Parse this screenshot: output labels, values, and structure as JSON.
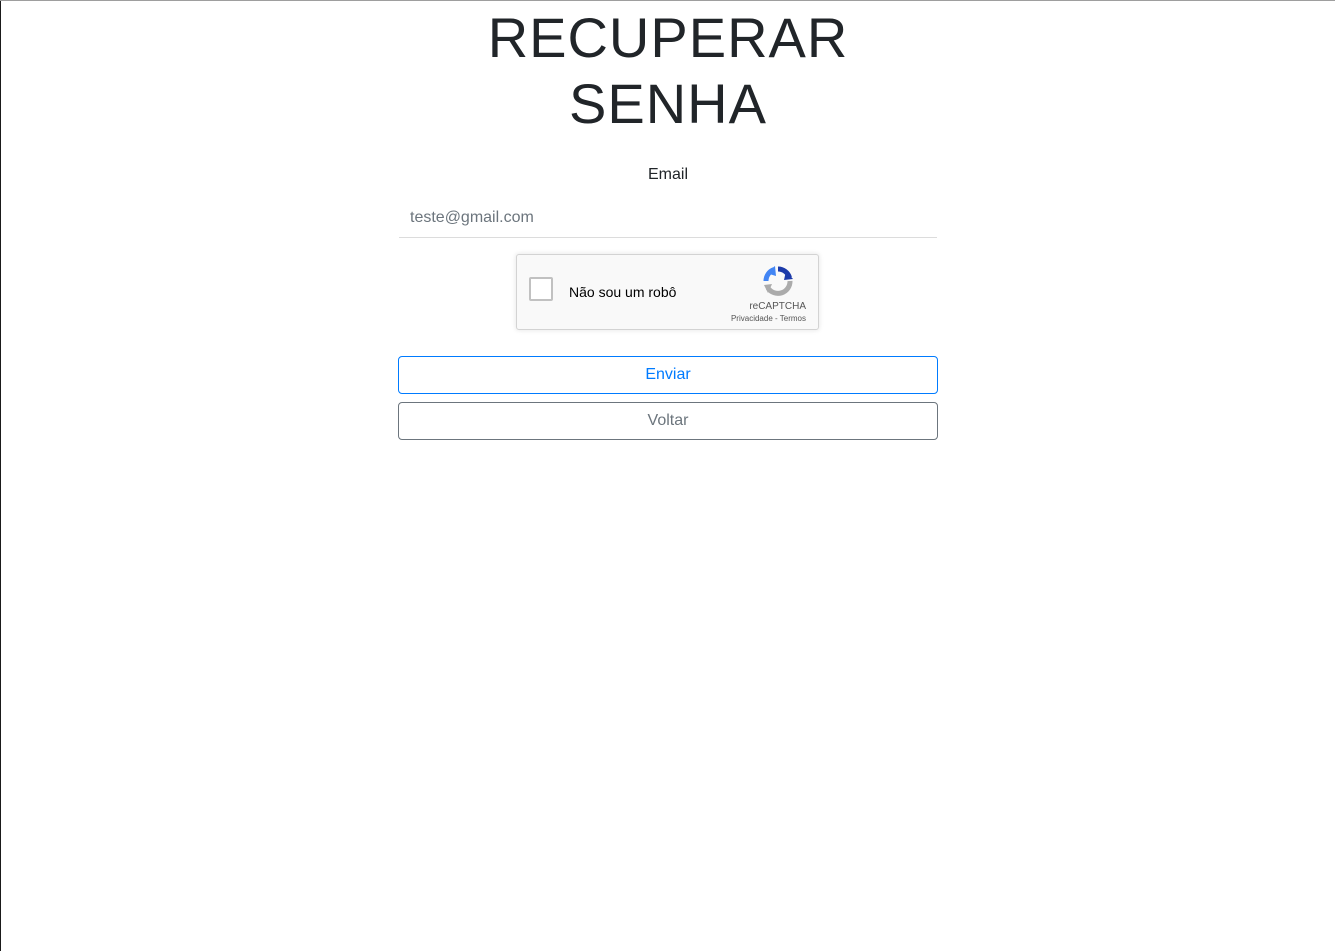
{
  "page": {
    "title": "RECUPERAR SENHA"
  },
  "form": {
    "email_label": "Email",
    "email_placeholder": "teste@gmail.com",
    "send_label": "Enviar",
    "back_label": "Voltar"
  },
  "captcha": {
    "checkbox_label": "Não sou um robô",
    "brand": "reCAPTCHA",
    "privacy_link": "Privacidade",
    "separator": "-",
    "terms_link": "Termos",
    "logo_icon": "recaptcha-logo-icon"
  },
  "colors": {
    "primary": "#007bff",
    "secondary": "#6c757d",
    "text": "#212529"
  }
}
